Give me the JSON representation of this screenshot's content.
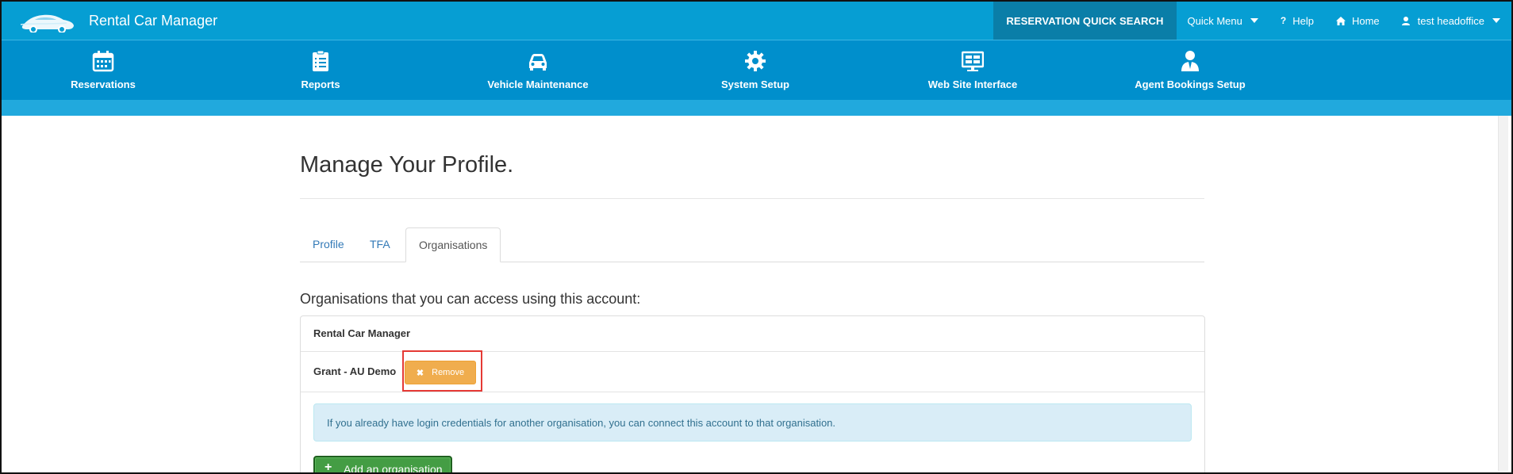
{
  "app": {
    "name": "Rental Car Manager"
  },
  "topnav": {
    "quick_search": "RESERVATION QUICK SEARCH",
    "quick_menu": "Quick Menu",
    "help": "Help",
    "home": "Home",
    "user": "test headoffice"
  },
  "mainnav": {
    "items": [
      {
        "label": "Reservations",
        "icon": "calendar-icon"
      },
      {
        "label": "Reports",
        "icon": "clipboard-icon"
      },
      {
        "label": "Vehicle Maintenance",
        "icon": "car-icon"
      },
      {
        "label": "System Setup",
        "icon": "gear-icon"
      },
      {
        "label": "Web Site Interface",
        "icon": "monitor-icon"
      },
      {
        "label": "Agent Bookings Setup",
        "icon": "agent-icon"
      }
    ]
  },
  "page": {
    "title": "Manage Your Profile.",
    "tabs": [
      {
        "label": "Profile",
        "active": false
      },
      {
        "label": "TFA",
        "active": false
      },
      {
        "label": "Organisations",
        "active": true
      }
    ],
    "subheading": "Organisations that you can access using this account:",
    "organisations": [
      {
        "name": "Rental Car Manager"
      },
      {
        "name": "Grant - AU Demo",
        "remove_label": "Remove"
      }
    ],
    "info_text": "If you already have login credentials for another organisation, you can connect this account to that organisation.",
    "add_button": "Add an organisation"
  },
  "colors": {
    "topbar": "#069ed3",
    "mainnav": "#008fcc",
    "remove": "#f0ad4e",
    "add": "#449d44",
    "highlight": "#e53935"
  }
}
